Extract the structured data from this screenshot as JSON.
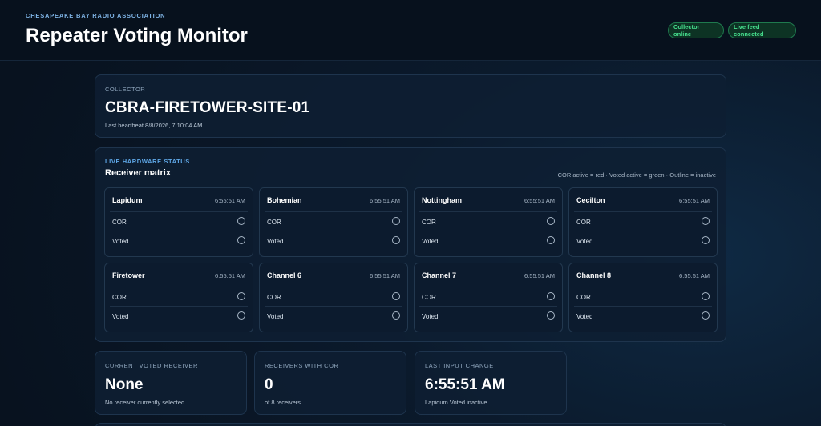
{
  "header": {
    "org": "CHESAPEAKE BAY RADIO ASSOCIATION",
    "title": "Repeater Voting Monitor",
    "status_pills": [
      "Collector online",
      "Live feed connected"
    ]
  },
  "collector": {
    "label": "COLLECTOR",
    "name": "CBRA-FIRETOWER-SITE-01",
    "heartbeat": "Last heartbeat 8/8/2026, 7:10:04 AM"
  },
  "matrix": {
    "kicker": "LIVE HARDWARE STATUS",
    "title": "Receiver matrix",
    "legend": "COR active = red · Voted active = green · Outline = inactive",
    "row_labels": {
      "cor": "COR",
      "voted": "Voted"
    },
    "receivers": [
      {
        "name": "Lapidum",
        "time": "6:55:51 AM",
        "cor": false,
        "voted": false
      },
      {
        "name": "Bohemian",
        "time": "6:55:51 AM",
        "cor": false,
        "voted": false
      },
      {
        "name": "Nottingham",
        "time": "6:55:51 AM",
        "cor": false,
        "voted": false
      },
      {
        "name": "Cecilton",
        "time": "6:55:51 AM",
        "cor": false,
        "voted": false
      },
      {
        "name": "Firetower",
        "time": "6:55:51 AM",
        "cor": false,
        "voted": false
      },
      {
        "name": "Channel 6",
        "time": "6:55:51 AM",
        "cor": false,
        "voted": false
      },
      {
        "name": "Channel 7",
        "time": "6:55:51 AM",
        "cor": false,
        "voted": false
      },
      {
        "name": "Channel 8",
        "time": "6:55:51 AM",
        "cor": false,
        "voted": false
      }
    ]
  },
  "stats": [
    {
      "label": "CURRENT VOTED RECEIVER",
      "value": "None",
      "sub": "No receiver currently selected"
    },
    {
      "label": "RECEIVERS WITH COR",
      "value": "0",
      "sub": "of 8 receivers"
    },
    {
      "label": "LAST INPUT CHANGE",
      "value": "6:55:51 AM",
      "sub": "Lapidum Voted inactive"
    }
  ],
  "colors": {
    "accent": "#5fa8e8",
    "online_green": "#47e08f",
    "cor_active": "#e5484d",
    "voted_active": "#30c46f"
  }
}
